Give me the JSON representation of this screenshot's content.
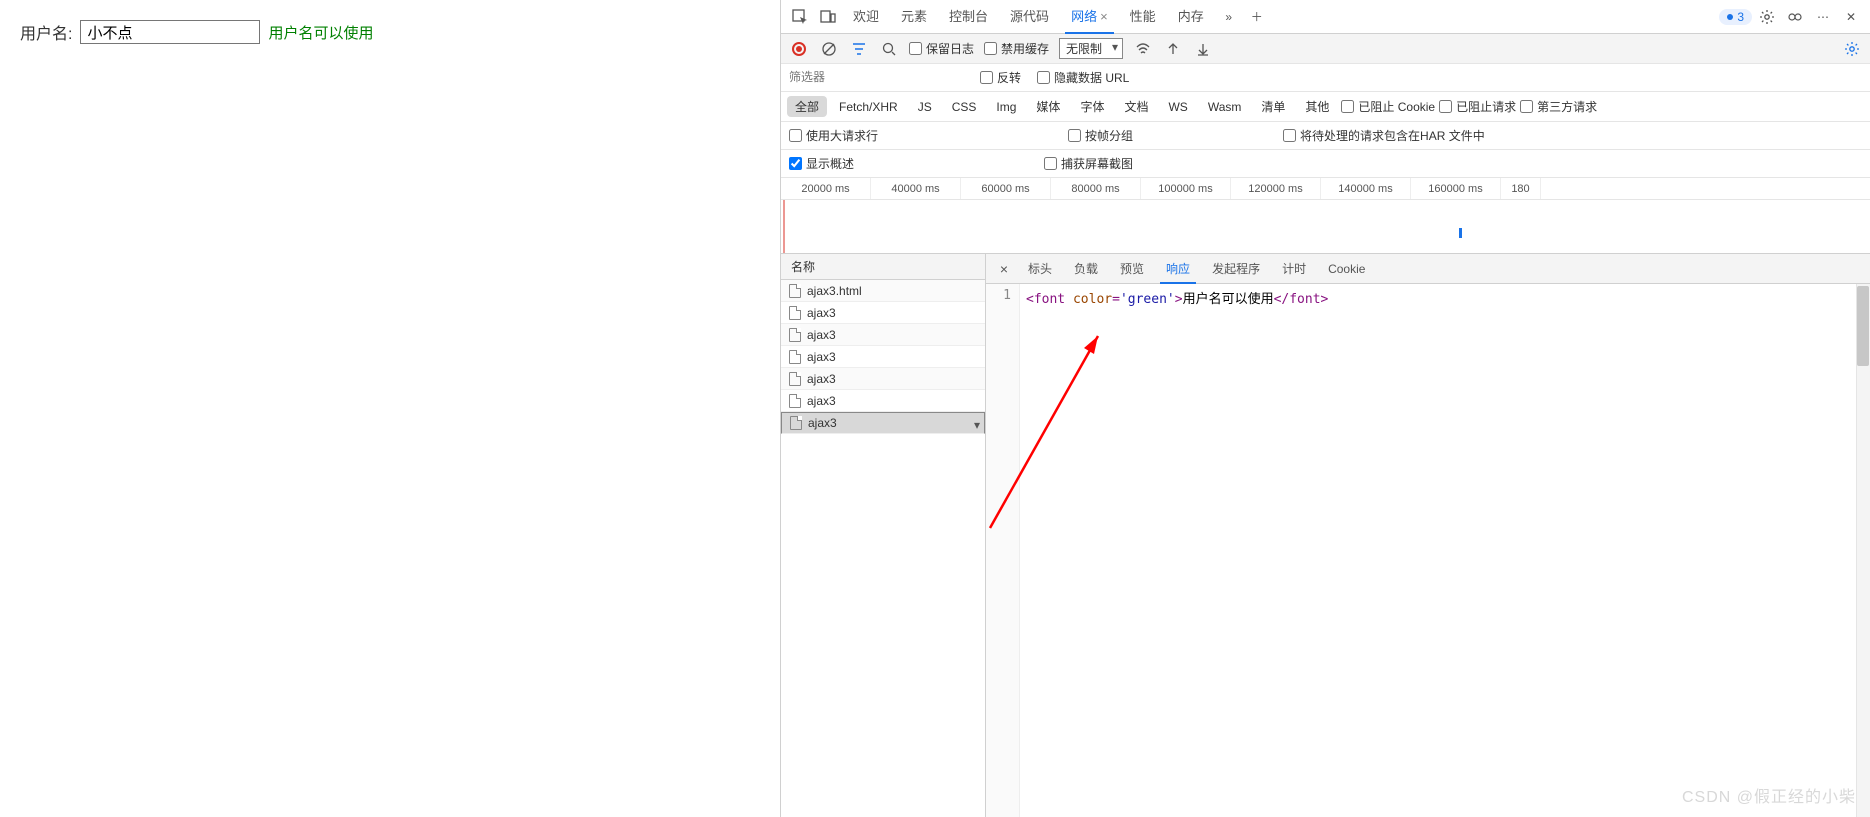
{
  "page": {
    "label": "用户名:",
    "value": "小不点",
    "msg": "用户名可以使用"
  },
  "devtools": {
    "tabs": [
      "欢迎",
      "元素",
      "控制台",
      "源代码",
      "网络",
      "性能",
      "内存"
    ],
    "activeTab": "网络",
    "issuesCount": "3",
    "toolbar": {
      "keepLog": "保留日志",
      "disableCache": "禁用缓存",
      "throttle": "无限制"
    },
    "filter": {
      "placeholder": "筛选器",
      "invert": "反转",
      "hideDataUrl": "隐藏数据 URL"
    },
    "types": [
      "全部",
      "Fetch/XHR",
      "JS",
      "CSS",
      "Img",
      "媒体",
      "字体",
      "文档",
      "WS",
      "Wasm",
      "清单",
      "其他"
    ],
    "typeExtras": {
      "blockedCookie": "已阻止 Cookie",
      "blockedReq": "已阻止请求",
      "thirdParty": "第三方请求"
    },
    "opts": {
      "bigRows": "使用大请求行",
      "groupByFrame": "按帧分组",
      "includePending": "将待处理的请求包含在HAR 文件中",
      "showOverview": "显示概述",
      "captureScreens": "捕获屏幕截图"
    },
    "timeline": [
      "20000 ms",
      "40000 ms",
      "60000 ms",
      "80000 ms",
      "100000 ms",
      "120000 ms",
      "140000 ms",
      "160000 ms",
      "180"
    ],
    "reqHead": "名称",
    "requests": [
      "ajax3.html",
      "ajax3",
      "ajax3",
      "ajax3",
      "ajax3",
      "ajax3",
      "ajax3"
    ],
    "selectedIndex": 6,
    "detailTabs": [
      "标头",
      "负载",
      "预览",
      "响应",
      "发起程序",
      "计时",
      "Cookie"
    ],
    "detailActive": "响应",
    "response": {
      "lineNo": "1",
      "open1": "<font ",
      "attr": "color",
      "eq": "=",
      "val": "'green'",
      "close1": ">",
      "text": "用户名可以使用",
      "open2": "</font>",
      "close2": ""
    }
  },
  "watermark": "CSDN @假正经的小柴"
}
